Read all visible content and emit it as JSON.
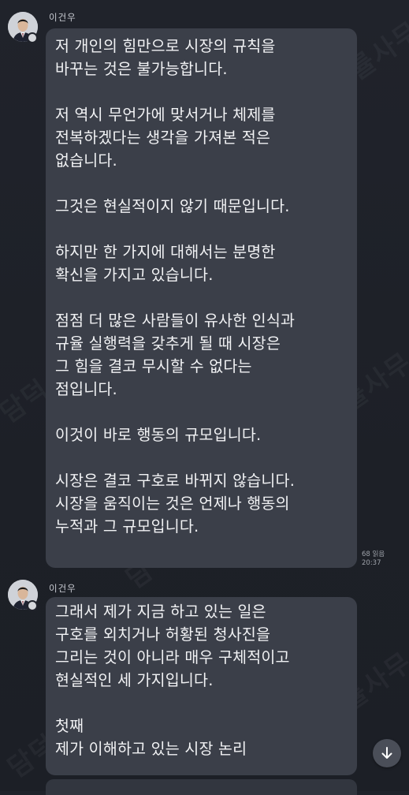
{
  "messages": [
    {
      "sender": "이건우",
      "lines": [
        "저 개인의 힘만으로 시장의 규칙을",
        "바꾸는 것은 불가능합니다.",
        "",
        "저 역시 무언가에 맞서거나 체제를",
        "전복하겠다는 생각을 가져본 적은",
        "없습니다.",
        "",
        "그것은 현실적이지 않기 때문입니다.",
        "",
        "하지만 한 가지에 대해서는 분명한",
        "확신을 가지고 있습니다.",
        "",
        "점점 더 많은 사람들이 유사한 인식과",
        "규율 실행력을 갖추게 될 때 시장은",
        "그 힘을 결코 무시할 수 없다는",
        "점입니다.",
        "",
        "이것이 바로 행동의 규모입니다.",
        "",
        "시장은 결코 구호로 바뀌지 않습니다.",
        "시장을 움직이는 것은 언제나 행동의",
        "누적과 그 규모입니다."
      ],
      "read_count": "68 읽음",
      "time": "20:37"
    },
    {
      "sender": "이건우",
      "lines": [
        "그래서 제가 지금 하고 있는 일은",
        "구호를 외치거나 허황된 청사진을",
        "그리는 것이 아니라 매우 구체적이고",
        "현실적인 세 가지입니다.",
        "",
        "첫째",
        "제가 이해하고 있는 시장 논리"
      ]
    }
  ],
  "watermark_text": "담덕 법률사무소",
  "icons": {
    "avatar": "person-avatar-icon",
    "scroll_down": "arrow-down-icon"
  },
  "colors": {
    "background": "#1f222a",
    "bubble": "#3b3f49",
    "text": "#f1f2f4",
    "meta": "#9ea2aa"
  }
}
